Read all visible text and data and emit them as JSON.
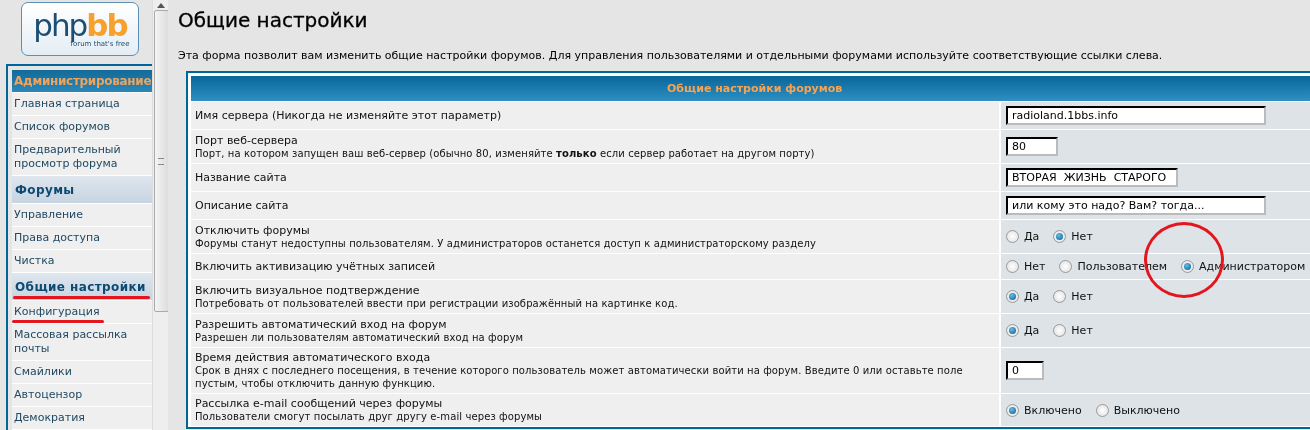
{
  "logo": {
    "brand_start": "php",
    "brand_end": "bb",
    "tagline": "forum that's free"
  },
  "sidebar": {
    "sections": [
      {
        "kind": "main",
        "title": "Администрирование",
        "marked": false,
        "items": [
          {
            "label": "Главная страница",
            "marked": false
          },
          {
            "label": "Список форумов",
            "marked": false
          },
          {
            "label": "Предварительный просмотр форума",
            "marked": false
          }
        ]
      },
      {
        "kind": "group",
        "title": "Форумы",
        "marked": false,
        "items": [
          {
            "label": "Управление",
            "marked": false
          },
          {
            "label": "Права доступа",
            "marked": false
          },
          {
            "label": "Чистка",
            "marked": false
          }
        ]
      },
      {
        "kind": "group",
        "title": "Общие настройки",
        "marked": true,
        "items": [
          {
            "label": "Конфигурация",
            "marked": true
          },
          {
            "label": "Массовая рассылка почты",
            "marked": false
          },
          {
            "label": "Смайлики",
            "marked": false
          },
          {
            "label": "Автоцензор",
            "marked": false
          },
          {
            "label": "Демократия",
            "marked": false
          }
        ]
      }
    ]
  },
  "page": {
    "title": "Общие настройки",
    "description": "Эта форма позволит вам изменить общие настройки форумов. Для управления пользователями и отдельными форумами используйте соответствующие ссылки слева."
  },
  "table": {
    "header": "Общие настройки форумов",
    "rows": [
      {
        "kind": "text",
        "label": "Имя сервера (Никогда не изменяйте этот параметр)",
        "value": "radioland.1bbs.info"
      },
      {
        "kind": "text",
        "label": "Порт веб-сервера",
        "hint": "Порт, на котором запущен ваш веб-сервер (обычно 80, изменяйте **только** если сервер работает на другом порту)",
        "value": "80"
      },
      {
        "kind": "text",
        "label": "Название сайта",
        "value": "ВТОРАЯ  ЖИЗНЬ  СТАРОГО"
      },
      {
        "kind": "text",
        "label": "Описание сайта",
        "value": "или кому это надо? Вам? тогда..."
      },
      {
        "kind": "radio",
        "label": "Отключить форумы",
        "hint": "Форумы станут недоступны пользователям. У администраторов останется доступ к администраторскому разделу",
        "options": [
          {
            "label": "Да",
            "selected": false,
            "circled": false
          },
          {
            "label": "Нет",
            "selected": true,
            "circled": false
          }
        ]
      },
      {
        "kind": "radio",
        "label": "Включить активизацию учётных записей",
        "options": [
          {
            "label": "Нет",
            "selected": false,
            "circled": false
          },
          {
            "label": "Пользователем",
            "selected": false,
            "circled": false
          },
          {
            "label": "Администратором",
            "selected": true,
            "circled": true
          }
        ]
      },
      {
        "kind": "radio",
        "label": "Включить визуальное подтверждение",
        "hint": "Потребовать от пользователей ввести при регистрации изображённый на картинке код.",
        "options": [
          {
            "label": "Да",
            "selected": true,
            "circled": false
          },
          {
            "label": "Нет",
            "selected": false,
            "circled": false
          }
        ]
      },
      {
        "kind": "radio",
        "label": "Разрешить автоматический вход на форум",
        "hint": "Разрешен ли пользователям автоматический вход на форум",
        "options": [
          {
            "label": "Да",
            "selected": true,
            "circled": false
          },
          {
            "label": "Нет",
            "selected": false,
            "circled": false
          }
        ]
      },
      {
        "kind": "text",
        "label": "Время действия автоматического входа",
        "hint": "Срок в днях с последнего посещения, в течение которого пользователь может автоматически войти на форум. Введите 0 или оставьте поле пустым, чтобы отключить данную функцию.",
        "value": "0"
      },
      {
        "kind": "radio",
        "label": "Рассылка e-mail сообщений через форумы",
        "hint": "Пользователи смогут посылать друг другу e-mail через форумы",
        "options": [
          {
            "label": "Включено",
            "selected": true,
            "circled": false
          },
          {
            "label": "Выключено",
            "selected": false,
            "circled": false
          }
        ]
      }
    ]
  }
}
